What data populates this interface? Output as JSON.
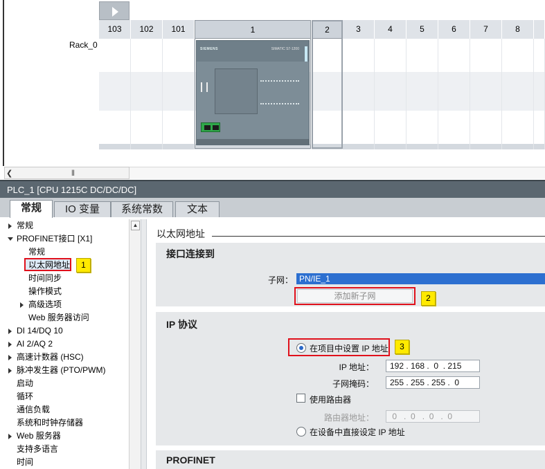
{
  "device_view": {
    "rack_label": "Rack_0",
    "slots": [
      "103",
      "102",
      "101",
      "1",
      "2",
      "3",
      "4",
      "5",
      "6",
      "7",
      "8"
    ],
    "module": {
      "brand": "SIEMENS",
      "model": "SIMATIC S7-1200",
      "cpu_text": "CPU 1215C DC/DC/DC"
    }
  },
  "inspector": {
    "title": "PLC_1 [CPU 1215C DC/DC/DC]",
    "tabs": [
      {
        "label": "常规",
        "active": true
      },
      {
        "label": "IO 变量",
        "active": false
      },
      {
        "label": "系统常数",
        "active": false
      },
      {
        "label": "文本",
        "active": false
      }
    ],
    "nav": [
      {
        "label": "常规",
        "level": 0,
        "caret": "right"
      },
      {
        "label": "PROFINET接口 [X1]",
        "level": 0,
        "caret": "down"
      },
      {
        "label": "常规",
        "level": 1,
        "caret": "none"
      },
      {
        "label": "以太网地址",
        "level": 1,
        "caret": "none",
        "selected": true
      },
      {
        "label": "时间同步",
        "level": 1,
        "caret": "none"
      },
      {
        "label": "操作模式",
        "level": 1,
        "caret": "none"
      },
      {
        "label": "高级选项",
        "level": 1,
        "caret": "right"
      },
      {
        "label": "Web 服务器访问",
        "level": 1,
        "caret": "none"
      },
      {
        "label": "DI 14/DQ 10",
        "level": 0,
        "caret": "right"
      },
      {
        "label": "AI 2/AQ 2",
        "level": 0,
        "caret": "right"
      },
      {
        "label": "高速计数器 (HSC)",
        "level": 0,
        "caret": "right"
      },
      {
        "label": "脉冲发生器 (PTO/PWM)",
        "level": 0,
        "caret": "right"
      },
      {
        "label": "启动",
        "level": 0,
        "caret": "none"
      },
      {
        "label": "循环",
        "level": 0,
        "caret": "none"
      },
      {
        "label": "通信负载",
        "level": 0,
        "caret": "none"
      },
      {
        "label": "系统和时钟存储器",
        "level": 0,
        "caret": "none"
      },
      {
        "label": "Web 服务器",
        "level": 0,
        "caret": "right"
      },
      {
        "label": "支持多语言",
        "level": 0,
        "caret": "none"
      },
      {
        "label": "时间",
        "level": 0,
        "caret": "none"
      }
    ]
  },
  "content": {
    "section_title": "以太网地址",
    "interface": {
      "title": "接口连接到",
      "subnet_label": "子网：",
      "subnet_value": "PN/IE_1",
      "add_subnet_button": "添加新子网"
    },
    "ip": {
      "title": "IP 协议",
      "option_project": "在项目中设置 IP 地址",
      "option_project_checked": true,
      "ip_label": "IP 地址：",
      "ip_value": "192 . 168 .  0  . 215",
      "mask_label": "子网掩码：",
      "mask_value": "255 . 255 . 255 .  0",
      "use_router": "使用路由器",
      "use_router_checked": false,
      "router_label": "路由器地址：",
      "router_value": " 0   .  0   .  0   .  0",
      "option_device": "在设备中直接设定 IP 地址",
      "option_device_checked": false
    },
    "profinet_title": "PROFINET"
  },
  "callouts": [
    "1",
    "2",
    "3"
  ],
  "colors": {
    "title_bar": "#5b6770",
    "highlight_red": "#e0101b",
    "callout_yellow": "#ffea00",
    "selection_blue": "#2c6fd0"
  }
}
